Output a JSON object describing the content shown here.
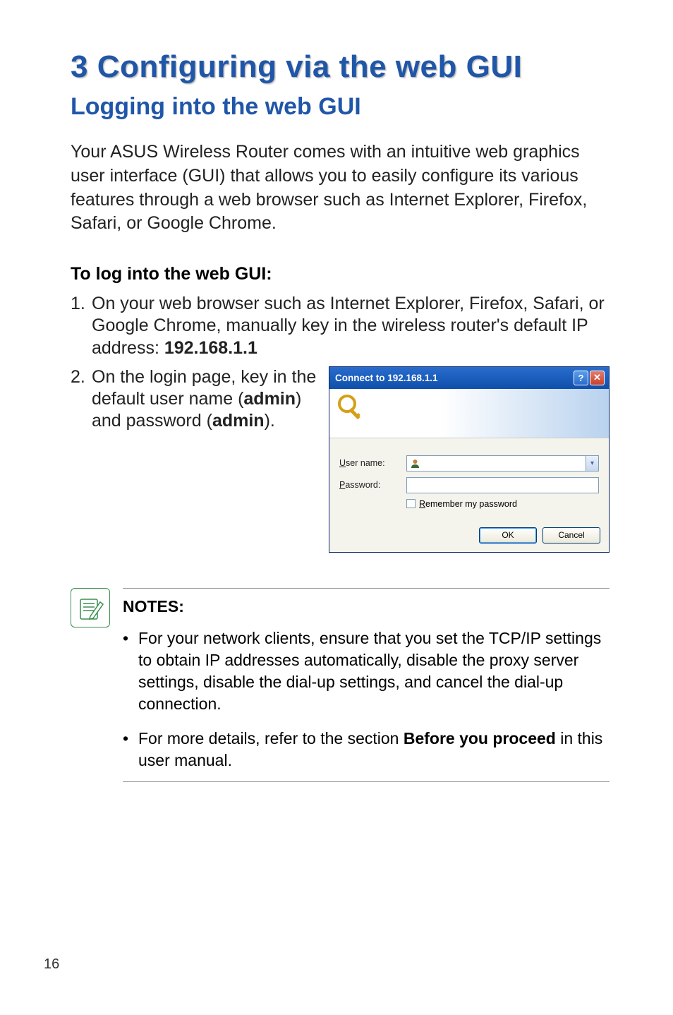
{
  "chapter": {
    "title": "3    Configuring via the web GUI"
  },
  "section": {
    "title": "Logging into the web GUI"
  },
  "intro": "Your ASUS Wireless Router comes with an intuitive web graphics user interface (GUI) that allows you to easily configure its various features through a web browser such as Internet Explorer, Firefox, Safari, or Google Chrome.",
  "subheading": "To log into the web GUI:",
  "steps": {
    "s1": {
      "num": "1.",
      "pre": "On your web browser such as Internet Explorer, Firefox, Safari, or Google Chrome, manually key in the wireless router's default IP address: ",
      "bold": "192.168.1.1"
    },
    "s2": {
      "num": "2.",
      "pre": "On the login page, key in the default user name (",
      "b1": "admin",
      "mid": ") and password (",
      "b2": "admin",
      "post": ")."
    }
  },
  "dialog": {
    "title": "Connect to 192.168.1.1",
    "help": "?",
    "close": "✕",
    "username_label_u": "U",
    "username_label_rest": "ser name:",
    "password_label_p": "P",
    "password_label_rest": "assword:",
    "remember_r": "R",
    "remember_rest": "emember my password",
    "ok": "OK",
    "cancel": "Cancel",
    "dropdown_arrow": "▾"
  },
  "notes": {
    "label": "NOTES",
    "colon": ":",
    "n1": {
      "bullet": "•",
      "text": "For your network clients, ensure that you set the TCP/IP settings to obtain IP addresses automatically, disable the proxy server settings, disable the dial-up settings, and cancel the dial-up connection."
    },
    "n2": {
      "bullet": "•",
      "pre": "For more details, refer to the section ",
      "bold": "Before you proceed",
      "post": " in this user manual."
    }
  },
  "page_number": "16"
}
